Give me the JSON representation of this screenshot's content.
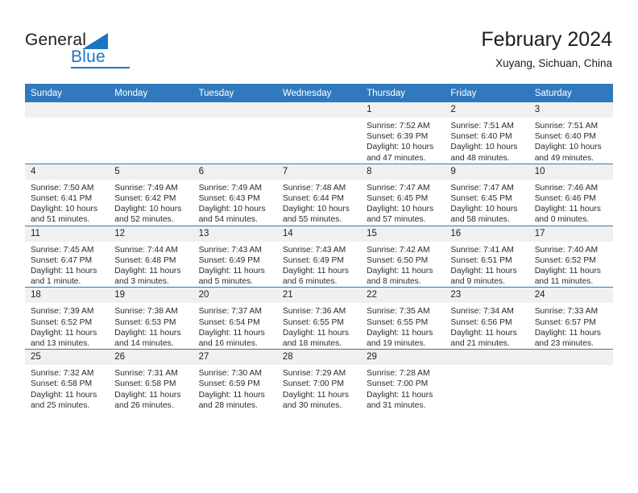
{
  "brand": {
    "name_part1": "General",
    "name_part2": "Blue",
    "accent_color": "#1c74c4",
    "triangle_icon": "triangle-icon"
  },
  "header": {
    "title": "February 2024",
    "subtitle": "Xuyang, Sichuan, China"
  },
  "calendar": {
    "header_bg": "#3079bd",
    "daynum_bg": "#f0f0f0",
    "weekdays": [
      "Sunday",
      "Monday",
      "Tuesday",
      "Wednesday",
      "Thursday",
      "Friday",
      "Saturday"
    ],
    "weeks": [
      [
        {
          "day": "",
          "empty": true
        },
        {
          "day": "",
          "empty": true
        },
        {
          "day": "",
          "empty": true
        },
        {
          "day": "",
          "empty": true
        },
        {
          "day": "1",
          "sunrise": "Sunrise: 7:52 AM",
          "sunset": "Sunset: 6:39 PM",
          "daylight": "Daylight: 10 hours and 47 minutes."
        },
        {
          "day": "2",
          "sunrise": "Sunrise: 7:51 AM",
          "sunset": "Sunset: 6:40 PM",
          "daylight": "Daylight: 10 hours and 48 minutes."
        },
        {
          "day": "3",
          "sunrise": "Sunrise: 7:51 AM",
          "sunset": "Sunset: 6:40 PM",
          "daylight": "Daylight: 10 hours and 49 minutes."
        }
      ],
      [
        {
          "day": "4",
          "sunrise": "Sunrise: 7:50 AM",
          "sunset": "Sunset: 6:41 PM",
          "daylight": "Daylight: 10 hours and 51 minutes."
        },
        {
          "day": "5",
          "sunrise": "Sunrise: 7:49 AM",
          "sunset": "Sunset: 6:42 PM",
          "daylight": "Daylight: 10 hours and 52 minutes."
        },
        {
          "day": "6",
          "sunrise": "Sunrise: 7:49 AM",
          "sunset": "Sunset: 6:43 PM",
          "daylight": "Daylight: 10 hours and 54 minutes."
        },
        {
          "day": "7",
          "sunrise": "Sunrise: 7:48 AM",
          "sunset": "Sunset: 6:44 PM",
          "daylight": "Daylight: 10 hours and 55 minutes."
        },
        {
          "day": "8",
          "sunrise": "Sunrise: 7:47 AM",
          "sunset": "Sunset: 6:45 PM",
          "daylight": "Daylight: 10 hours and 57 minutes."
        },
        {
          "day": "9",
          "sunrise": "Sunrise: 7:47 AM",
          "sunset": "Sunset: 6:45 PM",
          "daylight": "Daylight: 10 hours and 58 minutes."
        },
        {
          "day": "10",
          "sunrise": "Sunrise: 7:46 AM",
          "sunset": "Sunset: 6:46 PM",
          "daylight": "Daylight: 11 hours and 0 minutes."
        }
      ],
      [
        {
          "day": "11",
          "sunrise": "Sunrise: 7:45 AM",
          "sunset": "Sunset: 6:47 PM",
          "daylight": "Daylight: 11 hours and 1 minute."
        },
        {
          "day": "12",
          "sunrise": "Sunrise: 7:44 AM",
          "sunset": "Sunset: 6:48 PM",
          "daylight": "Daylight: 11 hours and 3 minutes."
        },
        {
          "day": "13",
          "sunrise": "Sunrise: 7:43 AM",
          "sunset": "Sunset: 6:49 PM",
          "daylight": "Daylight: 11 hours and 5 minutes."
        },
        {
          "day": "14",
          "sunrise": "Sunrise: 7:43 AM",
          "sunset": "Sunset: 6:49 PM",
          "daylight": "Daylight: 11 hours and 6 minutes."
        },
        {
          "day": "15",
          "sunrise": "Sunrise: 7:42 AM",
          "sunset": "Sunset: 6:50 PM",
          "daylight": "Daylight: 11 hours and 8 minutes."
        },
        {
          "day": "16",
          "sunrise": "Sunrise: 7:41 AM",
          "sunset": "Sunset: 6:51 PM",
          "daylight": "Daylight: 11 hours and 9 minutes."
        },
        {
          "day": "17",
          "sunrise": "Sunrise: 7:40 AM",
          "sunset": "Sunset: 6:52 PM",
          "daylight": "Daylight: 11 hours and 11 minutes."
        }
      ],
      [
        {
          "day": "18",
          "sunrise": "Sunrise: 7:39 AM",
          "sunset": "Sunset: 6:52 PM",
          "daylight": "Daylight: 11 hours and 13 minutes."
        },
        {
          "day": "19",
          "sunrise": "Sunrise: 7:38 AM",
          "sunset": "Sunset: 6:53 PM",
          "daylight": "Daylight: 11 hours and 14 minutes."
        },
        {
          "day": "20",
          "sunrise": "Sunrise: 7:37 AM",
          "sunset": "Sunset: 6:54 PM",
          "daylight": "Daylight: 11 hours and 16 minutes."
        },
        {
          "day": "21",
          "sunrise": "Sunrise: 7:36 AM",
          "sunset": "Sunset: 6:55 PM",
          "daylight": "Daylight: 11 hours and 18 minutes."
        },
        {
          "day": "22",
          "sunrise": "Sunrise: 7:35 AM",
          "sunset": "Sunset: 6:55 PM",
          "daylight": "Daylight: 11 hours and 19 minutes."
        },
        {
          "day": "23",
          "sunrise": "Sunrise: 7:34 AM",
          "sunset": "Sunset: 6:56 PM",
          "daylight": "Daylight: 11 hours and 21 minutes."
        },
        {
          "day": "24",
          "sunrise": "Sunrise: 7:33 AM",
          "sunset": "Sunset: 6:57 PM",
          "daylight": "Daylight: 11 hours and 23 minutes."
        }
      ],
      [
        {
          "day": "25",
          "sunrise": "Sunrise: 7:32 AM",
          "sunset": "Sunset: 6:58 PM",
          "daylight": "Daylight: 11 hours and 25 minutes."
        },
        {
          "day": "26",
          "sunrise": "Sunrise: 7:31 AM",
          "sunset": "Sunset: 6:58 PM",
          "daylight": "Daylight: 11 hours and 26 minutes."
        },
        {
          "day": "27",
          "sunrise": "Sunrise: 7:30 AM",
          "sunset": "Sunset: 6:59 PM",
          "daylight": "Daylight: 11 hours and 28 minutes."
        },
        {
          "day": "28",
          "sunrise": "Sunrise: 7:29 AM",
          "sunset": "Sunset: 7:00 PM",
          "daylight": "Daylight: 11 hours and 30 minutes."
        },
        {
          "day": "29",
          "sunrise": "Sunrise: 7:28 AM",
          "sunset": "Sunset: 7:00 PM",
          "daylight": "Daylight: 11 hours and 31 minutes."
        },
        {
          "day": "",
          "empty": true
        },
        {
          "day": "",
          "empty": true
        }
      ]
    ]
  }
}
